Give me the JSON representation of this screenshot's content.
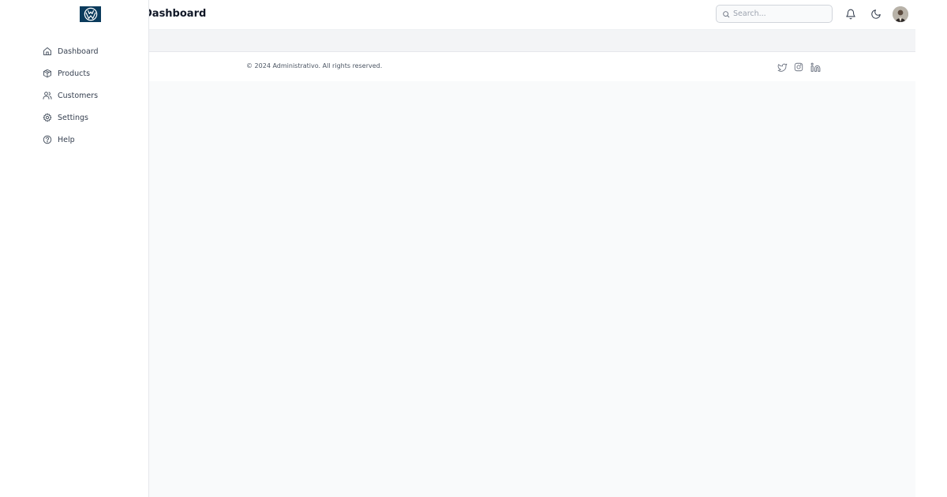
{
  "header": {
    "title": "Dashboard",
    "search_placeholder": "Search..."
  },
  "sidebar": {
    "items": [
      {
        "label": "Dashboard",
        "icon": "home-icon"
      },
      {
        "label": "Products",
        "icon": "box-icon"
      },
      {
        "label": "Customers",
        "icon": "users-icon"
      },
      {
        "label": "Settings",
        "icon": "gear-icon"
      },
      {
        "label": "Help",
        "icon": "help-circle-icon"
      }
    ]
  },
  "footer": {
    "copyright": "© 2024 Administrativo. All rights reserved.",
    "social": [
      "twitter-icon",
      "instagram-icon",
      "linkedin-icon"
    ]
  },
  "colors": {
    "logo_bg": "#0b3b5c",
    "page_bg": "#f9fafb",
    "text_muted": "#4b5563",
    "icon": "#4b5563"
  }
}
